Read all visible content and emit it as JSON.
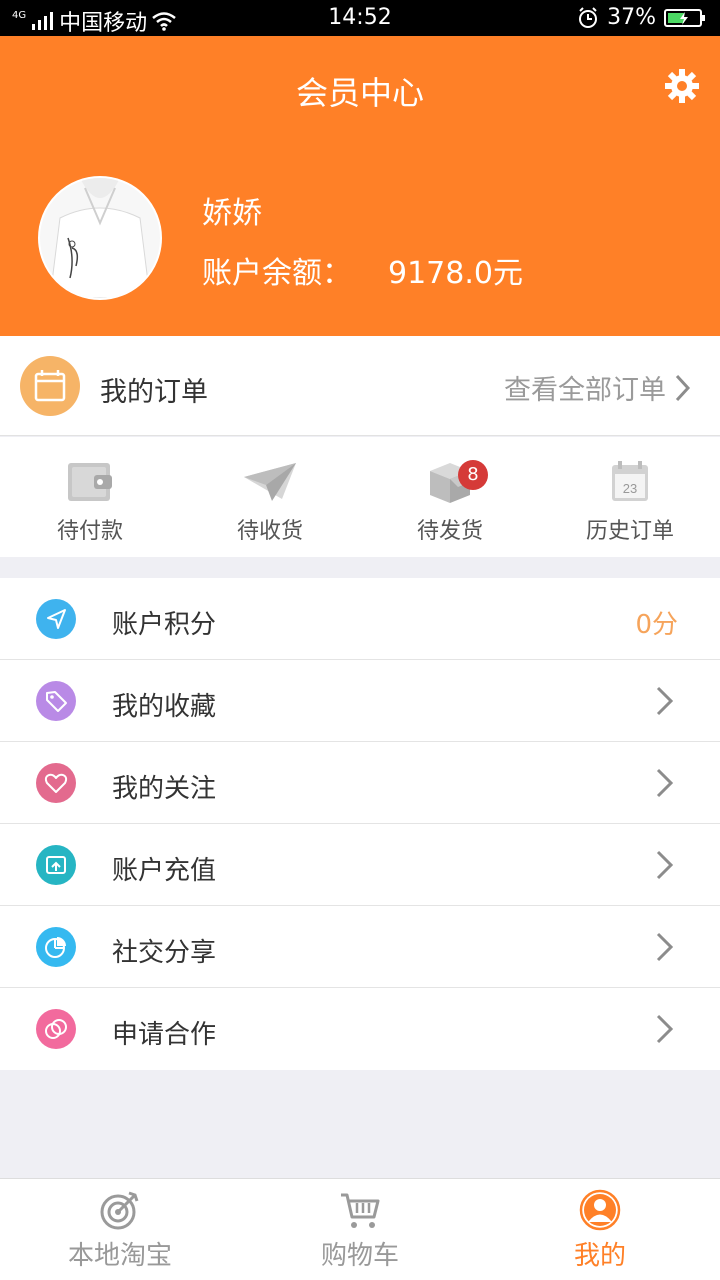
{
  "status_bar": {
    "network": "4G",
    "carrier": "中国移动",
    "time": "14:52",
    "battery": "37%"
  },
  "header": {
    "title": "会员中心",
    "username": "娇娇",
    "balance_label": "账户余额：",
    "balance_value": "9178.0元"
  },
  "orders": {
    "label": "我的订单",
    "view_all": "查看全部订单"
  },
  "order_status": [
    {
      "label": "待付款",
      "icon": "wallet-icon"
    },
    {
      "label": "待收货",
      "icon": "paper-plane-icon"
    },
    {
      "label": "待发货",
      "icon": "box-icon",
      "badge": "8"
    },
    {
      "label": "历史订单",
      "icon": "calendar-icon",
      "day": "23"
    }
  ],
  "menu": [
    {
      "label": "账户积分",
      "value": "0分",
      "icon": "navigation-icon",
      "color": "#3fb3ee"
    },
    {
      "label": "我的收藏",
      "icon": "tag-icon",
      "color": "#b98ae6"
    },
    {
      "label": "我的关注",
      "icon": "heart-icon",
      "color": "#e36a8e"
    },
    {
      "label": "账户充值",
      "icon": "recharge-icon",
      "color": "#26b5c3"
    },
    {
      "label": "社交分享",
      "icon": "pie-chart-icon",
      "color": "#35b9f0"
    },
    {
      "label": "申请合作",
      "icon": "rings-icon",
      "color": "#f26a9d"
    }
  ],
  "tabbar": [
    {
      "label": "本地淘宝",
      "icon": "target-icon"
    },
    {
      "label": "购物车",
      "icon": "cart-icon"
    },
    {
      "label": "我的",
      "icon": "user-icon",
      "active": true
    }
  ],
  "colors": {
    "brand": "#ff8027",
    "badge": "#d53a38",
    "points": "#f6a45b"
  }
}
